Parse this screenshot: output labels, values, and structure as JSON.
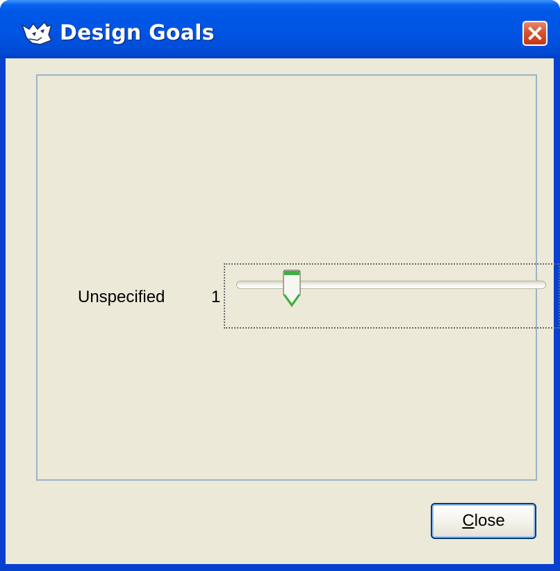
{
  "window": {
    "title": "Design Goals",
    "icon": "wolf-logo-icon",
    "close_icon": "close-x-icon"
  },
  "goal": {
    "label": "Unspecified",
    "min_label": "1",
    "slider_value_fraction": 0.18
  },
  "buttons": {
    "close_mnemonic": "C",
    "close_rest": "lose"
  },
  "colors": {
    "titlebar": "#0055e3",
    "client_bg": "#ece9d8",
    "panel_border": "#9bb3c7",
    "close_x": "#d8512f",
    "thumb_accent": "#3cb043"
  }
}
